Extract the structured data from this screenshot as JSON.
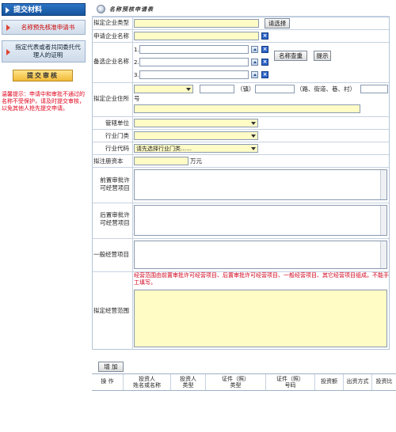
{
  "sidebar": {
    "title": "提交材料",
    "items": [
      {
        "label": "名称预先核准申请书"
      },
      {
        "label": "指定代表或者共同委托代理人的证明"
      }
    ],
    "submit_label": "提交审核",
    "tip": "温馨提示：申请中和审批不通过的名称不受保护，请及时提交审核，以免其他人抢先提交申请。"
  },
  "form": {
    "title": "名称预核申请表",
    "fields": {
      "company_type_label": "拟定企业类型",
      "select_label": "请选择",
      "applicant_name_label": "申请企业名称",
      "alt_names_label": "备选企业名称",
      "alt_nums": [
        "1.",
        "2.",
        "3."
      ],
      "name_check_label": "名称查重",
      "hint_label": "提示",
      "address_label": "拟定企业住所",
      "addr_town": "（镇）",
      "addr_road": "（路、街道、巷、村）",
      "addr_no": "号",
      "authority_label": "管辖单位",
      "industry_cat_label": "行业门类",
      "industry_code_label": "行业代码",
      "industry_code_value": "请先选择行业门类……",
      "capital_label": "拟注册资本",
      "capital_unit": "万元",
      "pre_permit_label": "前置审批许可经营项目",
      "post_permit_label": "后置审批许可经营项目",
      "general_label": "一般经营项目",
      "scope_label": "拟定经营范围",
      "scope_note": "经营范围由前置审批许可经营项目、后置审批许可经营项目、一般经营项目、其它经营项目组成。不能手工填写。"
    }
  },
  "investors": {
    "add_label": "增 加",
    "columns": [
      "操 作",
      "投资人\n姓名或名称",
      "投资人\n类型",
      "证件（照）\n类型",
      "证件（照）\n号码",
      "投资额",
      "出资方式",
      "投资比"
    ]
  }
}
